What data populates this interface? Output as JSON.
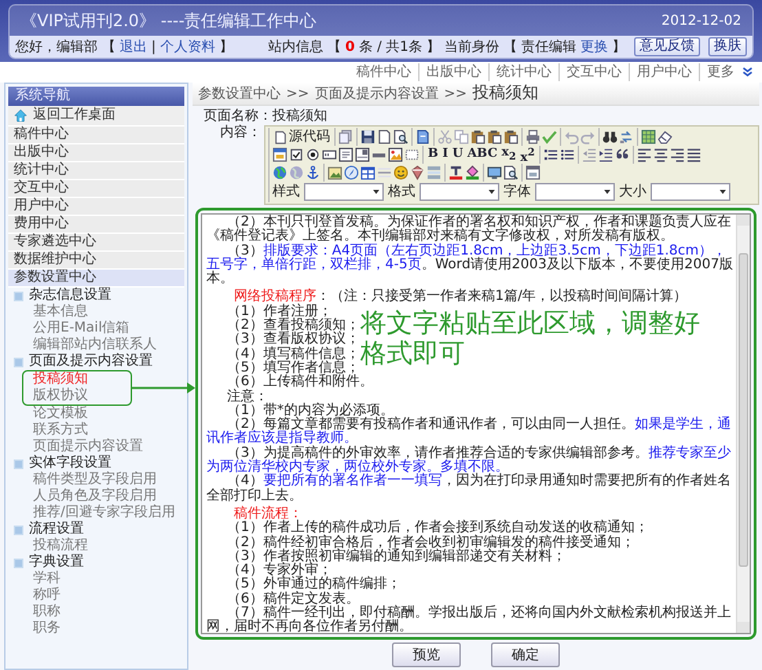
{
  "header": {
    "title": "《VIP试用刊2.0》 ----责任编辑工作中心",
    "date": "2012-12-02"
  },
  "user_bar": {
    "left": [
      {
        "kind": "text",
        "text": "您好，编辑部"
      },
      {
        "kind": "text",
        "text": "【"
      },
      {
        "kind": "link",
        "text": "退出"
      },
      {
        "kind": "text",
        "text": "|"
      },
      {
        "kind": "link",
        "text": "个人资料"
      },
      {
        "kind": "text",
        "text": "】"
      }
    ],
    "right": [
      {
        "kind": "text",
        "text": "站内信息"
      },
      {
        "kind": "text",
        "text": "【"
      },
      {
        "kind": "count",
        "text": "0"
      },
      {
        "kind": "text",
        "text": "条 / 共1条"
      },
      {
        "kind": "text",
        "text": "】"
      },
      {
        "kind": "text",
        "text": "当前身份"
      },
      {
        "kind": "text",
        "text": "【"
      },
      {
        "kind": "text",
        "text": "责任编辑"
      },
      {
        "kind": "link",
        "text": "更换"
      },
      {
        "kind": "text",
        "text": "】"
      }
    ],
    "buttons": [
      "意见反馈",
      "换肤"
    ]
  },
  "top_nav": [
    "稿件中心",
    "出版中心",
    "统计中心",
    "交互中心",
    "用户中心",
    "更多"
  ],
  "sidebar": {
    "title": "系统导航",
    "home": "返回工作桌面",
    "items": [
      {
        "label": "稿件中心",
        "selected": false
      },
      {
        "label": "出版中心",
        "selected": false
      },
      {
        "label": "统计中心",
        "selected": false
      },
      {
        "label": "交互中心",
        "selected": false
      },
      {
        "label": "用户中心",
        "selected": false
      },
      {
        "label": "费用中心",
        "selected": false
      },
      {
        "label": "专家遴选中心",
        "selected": false
      },
      {
        "label": "数据维护中心",
        "selected": false
      },
      {
        "label": "参数设置中心",
        "selected": true,
        "children": [
          {
            "label": "杂志信息设置",
            "children": [
              {
                "label": "基本信息",
                "selected": false,
                "highlighted": false
              },
              {
                "label": "公用E-Mail信箱",
                "selected": false,
                "highlighted": false
              },
              {
                "label": "编辑部站内信联系人",
                "selected": false,
                "highlighted": false
              }
            ]
          },
          {
            "label": "页面及提示内容设置",
            "children": [
              {
                "label": "投稿须知",
                "selected": true,
                "highlighted": true
              },
              {
                "label": "版权协议",
                "selected": false,
                "highlighted": true
              },
              {
                "label": "论文模板",
                "selected": false,
                "highlighted": false
              },
              {
                "label": "联系方式",
                "selected": false,
                "highlighted": false
              },
              {
                "label": "页面提示内容设置",
                "selected": false,
                "highlighted": false
              }
            ]
          },
          {
            "label": "实体字段设置",
            "children": [
              {
                "label": "稿件类型及字段启用",
                "selected": false,
                "highlighted": false
              },
              {
                "label": "人员角色及字段启用",
                "selected": false,
                "highlighted": false
              },
              {
                "label": "推荐/回避专家字段启用",
                "selected": false,
                "highlighted": false
              }
            ]
          },
          {
            "label": "流程设置",
            "children": [
              {
                "label": "投稿流程",
                "selected": false,
                "highlighted": false
              }
            ]
          },
          {
            "label": "字典设置",
            "children": [
              {
                "label": "学科",
                "selected": false,
                "highlighted": false
              },
              {
                "label": "称呼",
                "selected": false,
                "highlighted": false
              },
              {
                "label": "职称",
                "selected": false,
                "highlighted": false
              },
              {
                "label": "职务",
                "selected": false,
                "highlighted": false
              }
            ]
          }
        ]
      }
    ]
  },
  "breadcrumb": {
    "items": [
      "参数设置中心",
      "页面及提示内容设置",
      "投稿须知"
    ],
    "separator": ">>"
  },
  "form": {
    "page_name_label": "页面名称：",
    "page_name": "投稿须知",
    "content_label": "内容："
  },
  "editor": {
    "source_button": "源代码",
    "format_buttons": [
      "B",
      "I",
      "U",
      "ABC",
      "x$_{2}$",
      "x$^{2}$"
    ],
    "selects": [
      "样式",
      "格式",
      "字体",
      "大小"
    ],
    "annotation": "将文字粘贴至此区域，调整好格式即可",
    "content": [
      {
        "kind": "para",
        "segments": [
          {
            "color": "#222222",
            "text": "（2）本刊只刊登首发稿。为保证作者的署名权和知识产权，作者和课题负责人应在《稿件登记表》上签名。本刊编辑部对来稿有文字修改权，对所发稿有版权。"
          }
        ]
      },
      {
        "kind": "para",
        "segments": [
          {
            "color": "#222222",
            "text": "（3）"
          },
          {
            "color": "#1a1aee",
            "text": "排版要求：A4页面（左右页边距1.8cm，上边距3.5cm，下边距1.8cm），五号字，单倍行距，双栏排，4-5页"
          },
          {
            "color": "#222222",
            "text": "。Word请使用2003及以下版本，不要使用2007版本。"
          }
        ]
      },
      {
        "kind": "gap"
      },
      {
        "kind": "heading",
        "segments": [
          {
            "color": "#ee1a1a",
            "text": "网络投稿程序"
          },
          {
            "color": "#222222",
            "text": "：（注：只接受第一作者来稿1篇/年，以投稿时间间隔计算）"
          }
        ]
      },
      {
        "kind": "step",
        "segments": [
          {
            "color": "#222222",
            "text": "（1）作者注册；"
          }
        ]
      },
      {
        "kind": "step",
        "segments": [
          {
            "color": "#222222",
            "text": "（2）查看投稿须知；"
          }
        ]
      },
      {
        "kind": "step",
        "segments": [
          {
            "color": "#222222",
            "text": "（3）查看版权协议；"
          }
        ]
      },
      {
        "kind": "step",
        "segments": [
          {
            "color": "#222222",
            "text": "（4）填写稿件信息；"
          }
        ]
      },
      {
        "kind": "step",
        "segments": [
          {
            "color": "#222222",
            "text": "（5）填写作者信息；"
          }
        ]
      },
      {
        "kind": "step",
        "segments": [
          {
            "color": "#222222",
            "text": "（6）上传稿件和附件。"
          }
        ]
      },
      {
        "kind": "label",
        "segments": [
          {
            "color": "#222222",
            "text": "注意："
          }
        ]
      },
      {
        "kind": "para",
        "segments": [
          {
            "color": "#222222",
            "text": "（1）带*的内容为必添项。"
          }
        ]
      },
      {
        "kind": "para",
        "segments": [
          {
            "color": "#222222",
            "text": "（2）每篇文章都需要有投稿作者和通讯作者，可以由同一人担任。"
          },
          {
            "color": "#1a1aee",
            "text": "如果是学生，通讯作者应该是指导教师。"
          }
        ]
      },
      {
        "kind": "para",
        "segments": [
          {
            "color": "#222222",
            "text": "（3）为提高稿件的外审效率，请作者推荐合适的专家供编辑部参考。"
          },
          {
            "color": "#1a1aee",
            "text": "推荐专家至少为两位清华校内专家，两位校外专家。多填不限。"
          }
        ]
      },
      {
        "kind": "para",
        "segments": [
          {
            "color": "#222222",
            "text": "（4）"
          },
          {
            "color": "#1a1aee",
            "text": "要把所有的署名作者一一填写"
          },
          {
            "color": "#222222",
            "text": "，因为在打印录用通知时需要把所有的作者姓名全部打印上去。"
          }
        ]
      },
      {
        "kind": "gap"
      },
      {
        "kind": "heading",
        "segments": [
          {
            "color": "#ee1a1a",
            "text": "稿件流程："
          }
        ]
      },
      {
        "kind": "para",
        "segments": [
          {
            "color": "#222222",
            "text": "（1）作者上传的稿件成功后，作者会接到系统自动发送的收稿通知；"
          }
        ]
      },
      {
        "kind": "para",
        "segments": [
          {
            "color": "#222222",
            "text": "（2）稿件经初审合格后，作者会收到初审编辑发的稿件接受通知；"
          }
        ]
      },
      {
        "kind": "para",
        "segments": [
          {
            "color": "#222222",
            "text": "（3）作者按照初审编辑的通知到编辑部递交有关材料；"
          }
        ]
      },
      {
        "kind": "para",
        "segments": [
          {
            "color": "#222222",
            "text": "（4）专家外审；"
          }
        ]
      },
      {
        "kind": "para",
        "segments": [
          {
            "color": "#222222",
            "text": "（5）外审通过的稿件编排；"
          }
        ]
      },
      {
        "kind": "para",
        "segments": [
          {
            "color": "#222222",
            "text": "（6）稿件定文发表。"
          }
        ]
      },
      {
        "kind": "para",
        "segments": [
          {
            "color": "#222222",
            "text": "（7）稿件一经刊出，即付稿酬。学报出版后，还将向国内外文献检索机构报送并上网，届时不再向各位作者另付酬。"
          }
        ]
      }
    ]
  },
  "buttons": [
    "预览",
    "确定"
  ]
}
